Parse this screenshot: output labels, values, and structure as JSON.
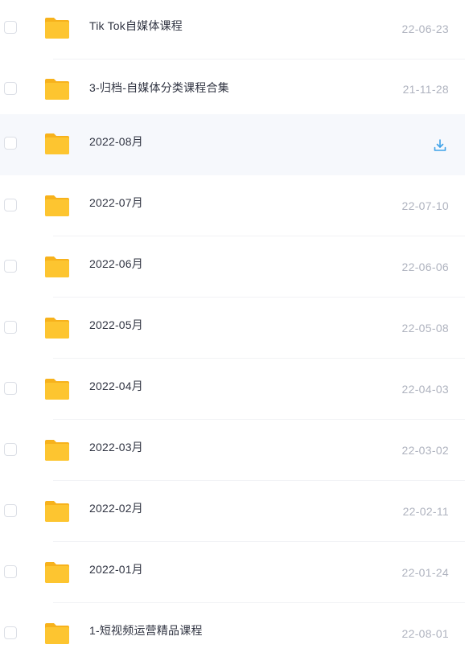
{
  "file_list": {
    "rows": [
      {
        "name": "Tik Tok自媒体课程",
        "date": "22-06-23",
        "icon": "folder-icon"
      },
      {
        "name": "3-归档-自媒体分类课程合集",
        "date": "21-11-28",
        "icon": "folder-icon"
      },
      {
        "name": "2022-08月",
        "date": "",
        "icon": "folder-icon",
        "hover_action": "download-icon",
        "hover": true
      },
      {
        "name": "2022-07月",
        "date": "22-07-10",
        "icon": "folder-icon"
      },
      {
        "name": "2022-06月",
        "date": "22-06-06",
        "icon": "folder-icon"
      },
      {
        "name": "2022-05月",
        "date": "22-05-08",
        "icon": "folder-icon"
      },
      {
        "name": "2022-04月",
        "date": "22-04-03",
        "icon": "folder-icon"
      },
      {
        "name": "2022-03月",
        "date": "22-03-02",
        "icon": "folder-icon"
      },
      {
        "name": "2022-02月",
        "date": "22-02-11",
        "icon": "folder-icon"
      },
      {
        "name": "2022-01月",
        "date": "22-01-24",
        "icon": "folder-icon"
      },
      {
        "name": "1-短视频运营精品课程",
        "date": "22-08-01",
        "icon": "folder-icon"
      }
    ]
  },
  "colors": {
    "folder_yellow": "#fdc530",
    "folder_back": "#f7b21c",
    "download_blue": "#3ea2e8",
    "name_text": "#303442",
    "date_text": "#afb3bf"
  }
}
